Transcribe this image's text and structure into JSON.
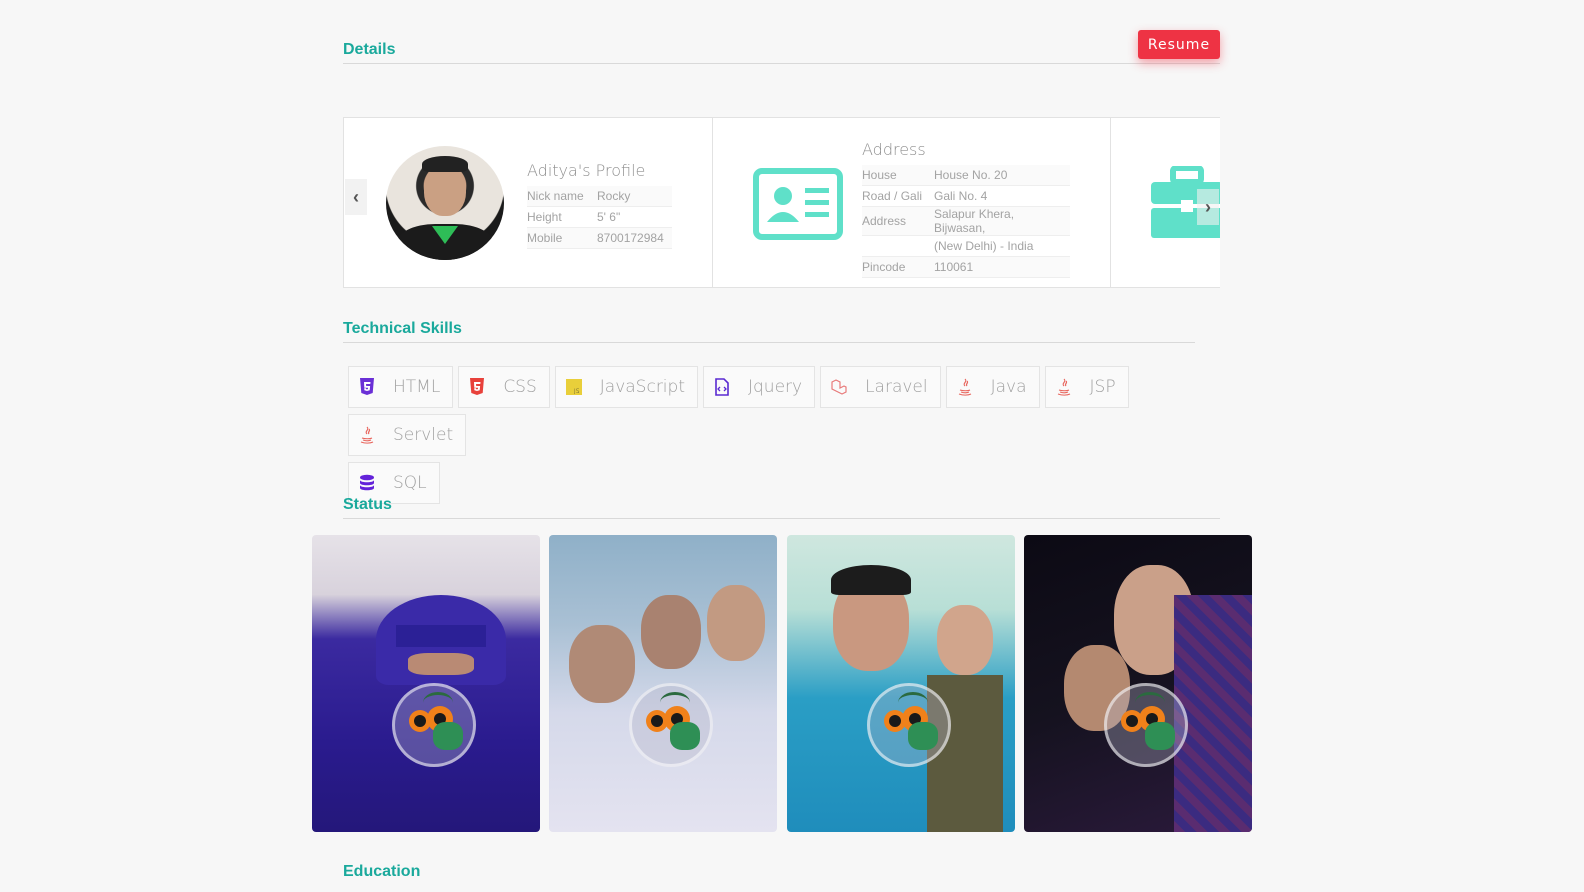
{
  "details": {
    "title": "Details",
    "resume_label": "Resume"
  },
  "profile": {
    "title": "Aditya's Profile",
    "rows": [
      {
        "k": "Nick name",
        "v": "Rocky"
      },
      {
        "k": "Height",
        "v": "5' 6\""
      },
      {
        "k": "Mobile",
        "v": "8700172984"
      }
    ]
  },
  "address": {
    "title": "Address",
    "rows": [
      {
        "k": "House",
        "v": "House No. 20"
      },
      {
        "k": "Road / Gali",
        "v": "Gali No. 4"
      },
      {
        "k": "Address",
        "v": "Salapur Khera, Bijwasan,"
      },
      {
        "k": "",
        "v": "(New Delhi) - India"
      },
      {
        "k": "Pincode",
        "v": "110061"
      }
    ]
  },
  "skills": {
    "title": "Technical Skills",
    "items": [
      {
        "label": "HTML",
        "icon": "html5-icon",
        "color": "#6a2fd6"
      },
      {
        "label": "CSS",
        "icon": "css3-icon",
        "color": "#e8413b"
      },
      {
        "label": "JavaScript",
        "icon": "javascript-icon",
        "color": "#e9cf3a"
      },
      {
        "label": "Jquery",
        "icon": "code-file-icon",
        "color": "#5a2ad1"
      },
      {
        "label": "Laravel",
        "icon": "laravel-icon",
        "color": "#e87a7a"
      },
      {
        "label": "Java",
        "icon": "java-icon",
        "color": "#e8665e"
      },
      {
        "label": "JSP",
        "icon": "java-icon",
        "color": "#e8665e"
      },
      {
        "label": "Servlet",
        "icon": "java-icon",
        "color": "#e8665e"
      },
      {
        "label": "SQL",
        "icon": "database-icon",
        "color": "#6322d9"
      }
    ]
  },
  "status": {
    "title": "Status"
  },
  "education": {
    "title": "Education"
  },
  "colors": {
    "accent": "#1aa99c",
    "resume": "#ee3344",
    "card_icon": "#5fe0c9"
  }
}
